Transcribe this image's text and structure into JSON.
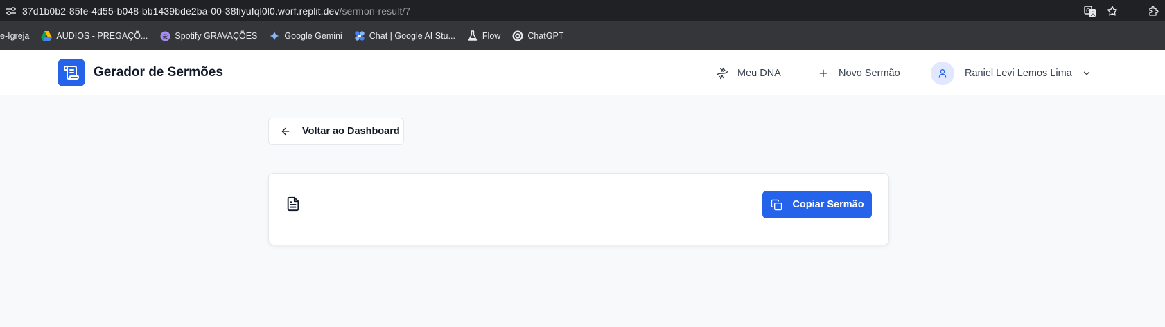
{
  "browser": {
    "url_host": "37d1b0b2-85fe-4d55-b048-bb1439bde2ba-00-38fiyufql0l0.worf.replit.dev",
    "url_path": "/sermon-result/7",
    "bookmarks": [
      {
        "label": "e-Igreja",
        "icon": "none"
      },
      {
        "label": "AUDIOS - PREGAÇÕ...",
        "icon": "google-drive-icon"
      },
      {
        "label": "Spotify GRAVAÇÕES",
        "icon": "spotify-icon"
      },
      {
        "label": "Google Gemini",
        "icon": "gemini-icon"
      },
      {
        "label": "Chat | Google AI Stu...",
        "icon": "ai-studio-icon"
      },
      {
        "label": "Flow",
        "icon": "flask-icon"
      },
      {
        "label": "ChatGPT",
        "icon": "openai-icon"
      }
    ]
  },
  "header": {
    "title": "Gerador de Sermões",
    "nav": {
      "dna_label": "Meu DNA",
      "new_label": "Novo Sermão"
    },
    "user": {
      "name": "Raniel Levi Lemos Lima"
    }
  },
  "main": {
    "back_label": "Voltar ao Dashboard",
    "copy_label": "Copiar Sermão"
  },
  "colors": {
    "accent": "#2563eb",
    "page_bg": "#f8f9fb",
    "chrome_dark": "#202124",
    "bookmarks_bg": "#35363a"
  }
}
